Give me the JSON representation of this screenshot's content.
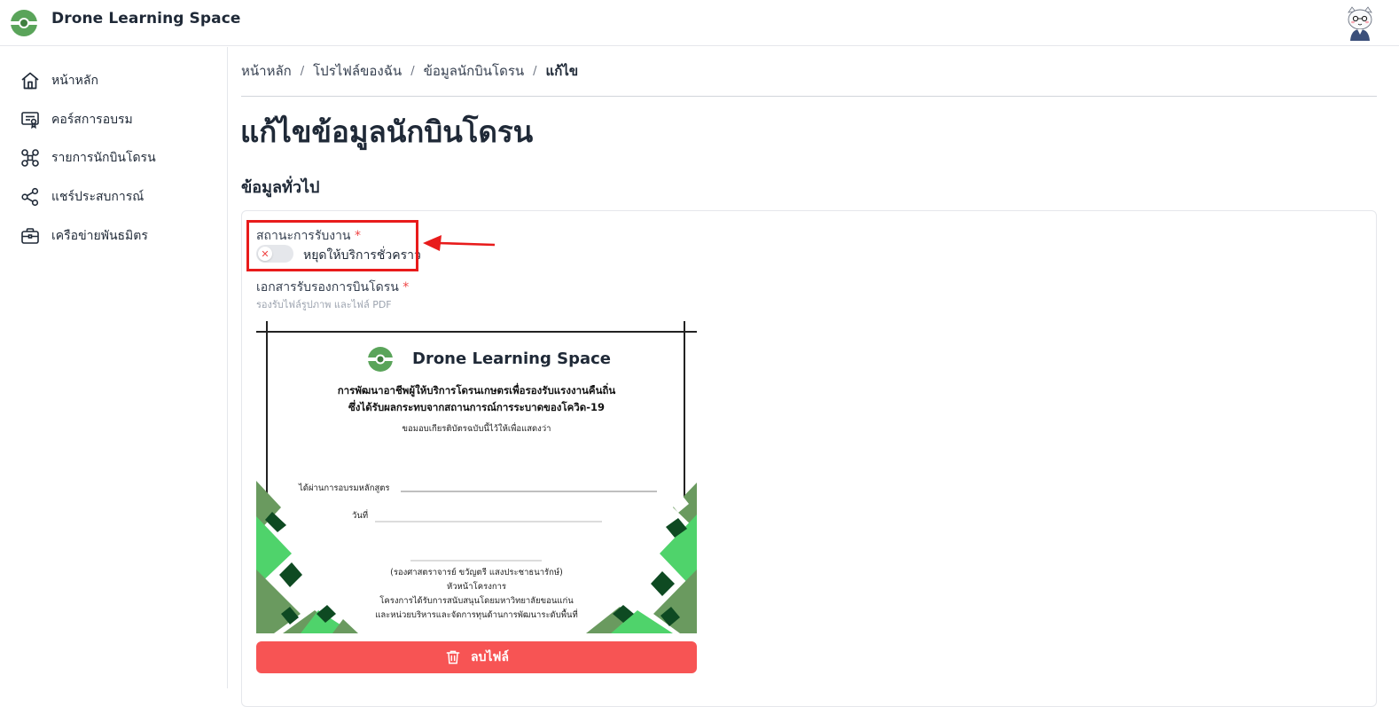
{
  "app": {
    "title": "Drone Learning Space"
  },
  "sidebar": {
    "items": [
      {
        "label": "หน้าหลัก",
        "icon": "home-icon"
      },
      {
        "label": "คอร์สการอบรม",
        "icon": "certificate-icon"
      },
      {
        "label": "รายการนักบินโดรน",
        "icon": "drone-icon"
      },
      {
        "label": "แชร์ประสบการณ์",
        "icon": "share-icon"
      },
      {
        "label": "เครือข่ายพันธมิตร",
        "icon": "briefcase-icon"
      }
    ]
  },
  "breadcrumb": {
    "items": [
      "หน้าหลัก",
      "โปรไฟล์ของฉัน",
      "ข้อมูลนักบินโดรน",
      "แก้ไข"
    ],
    "separator": "/"
  },
  "page": {
    "title": "แก้ไขข้อมูลนักบินโดรน",
    "section_title": "ข้อมูลทั่วไป"
  },
  "form": {
    "status_label": "สถานะการรับงาน",
    "required_mark": "*",
    "toggle_state": "off",
    "toggle_text": "หยุดให้บริการชั่วคราว",
    "document_label": "เอกสารรับรองการบินโดรน",
    "document_hint": "รองรับไฟล์รูปภาพ และไฟล์ PDF",
    "delete_label": "ลบไฟล์"
  },
  "certificate": {
    "brand": "Drone Learning Space",
    "line1": "การพัฒนาอาชีพผู้ให้บริการโดรนเกษตรเพื่อรองรับแรงงานคืนถิ่น",
    "line2": "ซึ่งได้รับผลกระทบจากสถานการณ์การระบาดของโควิด-19",
    "line3": "ขอมอบเกียรติบัตรฉบับนี้ไว้ให้เพื่อแสดงว่า",
    "field1": "ได้ผ่านการอบรมหลักสูตร",
    "field2": "วันที่",
    "signer": "(รองศาสตราจารย์ ขวัญตรี แสงประชาธนารักษ์)",
    "signer_role": "หัวหน้าโครงการ",
    "support1": "โครงการได้รับการสนับสนุนโดยมหาวิทยาลัยขอนแก่น",
    "support2": "และหน่วยบริหารและจัดการทุนด้านการพัฒนาระดับพื้นที่"
  },
  "colors": {
    "brand_green": "#4a9b4a",
    "annotation_red": "#e81b1b",
    "delete_button": "#f75454"
  }
}
